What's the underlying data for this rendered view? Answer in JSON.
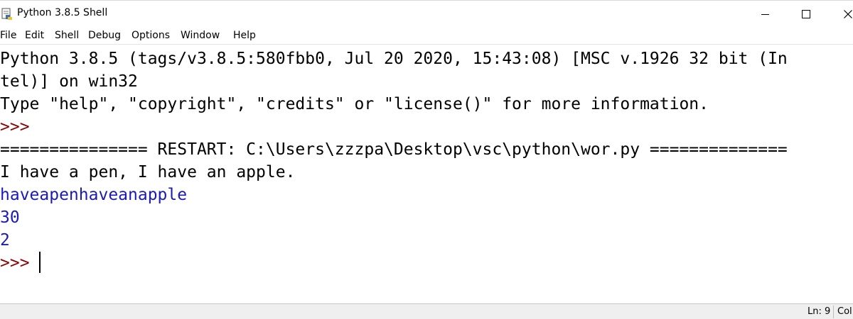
{
  "window": {
    "title": "Python 3.8.5 Shell",
    "icon": "python-idle-icon"
  },
  "menu": {
    "items": [
      {
        "label": "File"
      },
      {
        "label": "Edit"
      },
      {
        "label": "Shell"
      },
      {
        "label": "Debug"
      },
      {
        "label": "Options"
      },
      {
        "label": "Window"
      },
      {
        "label": "Help"
      }
    ]
  },
  "shell": {
    "lines": [
      {
        "text": "Python 3.8.5 (tags/v3.8.5:580fbb0, Jul 20 2020, 15:43:08) [MSC v.1926 32 bit (In",
        "kind": "banner"
      },
      {
        "text": "tel)] on win32",
        "kind": "banner"
      },
      {
        "text": "Type \"help\", \"copyright\", \"credits\" or \"license()\" for more information.",
        "kind": "banner"
      },
      {
        "text": ">>>",
        "kind": "prompt"
      },
      {
        "text": "=============== RESTART: C:\\Users\\zzzpa\\Desktop\\vsc\\python\\wor.py ==============",
        "kind": "restart"
      },
      {
        "text": "I have a pen, I have an apple.",
        "kind": "stdout-black"
      },
      {
        "text": "haveapenhaveanapple",
        "kind": "stdout"
      },
      {
        "text": "30",
        "kind": "stdout"
      },
      {
        "text": "2",
        "kind": "stdout"
      },
      {
        "text": ">>> ",
        "kind": "prompt"
      }
    ]
  },
  "status": {
    "ln": "Ln: 9",
    "col": "Col"
  },
  "colors": {
    "stdout": "#1b1bb4",
    "prompt": "#8b0000",
    "text": "#000000"
  }
}
